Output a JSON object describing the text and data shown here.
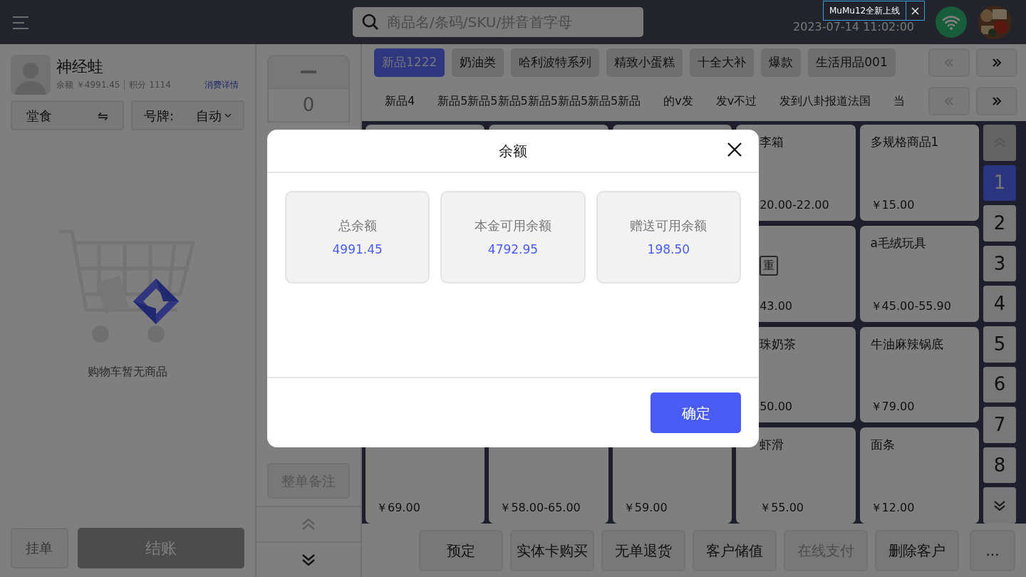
{
  "top_bar": {
    "search": {
      "placeholder": "商品名/条码/SKU/拼音首字母"
    },
    "datetime": "2023-07-14 11:02:00"
  },
  "notice": {
    "text": "MuMu12全新上线"
  },
  "customer": {
    "name": "神经蛙",
    "balance": "余额 ￥4991.45",
    "points": "积分 1114",
    "details_link": "消费详情"
  },
  "dining_mode": {
    "label": "堂食",
    "icon": "⇋"
  },
  "number_plate": {
    "label": "号牌:",
    "value": "自动"
  },
  "cart": {
    "empty_text": "购物车暂无商品"
  },
  "quantity": {
    "value": "0"
  },
  "order_note": "整单备注",
  "hold_button": {
    "label": "挂单",
    "disabled": true
  },
  "checkout_button": {
    "label": "结账",
    "disabled": true
  },
  "categories": [
    {
      "label": "新品1222",
      "selected": true
    },
    {
      "label": "奶油类",
      "selected": false
    },
    {
      "label": "哈利波特系列",
      "selected": false
    },
    {
      "label": "精致小蛋糕",
      "selected": false
    },
    {
      "label": "十全大补",
      "selected": false
    },
    {
      "label": "爆款",
      "selected": false
    },
    {
      "label": "生活用品001",
      "selected": false
    }
  ],
  "category_nav": {
    "prev_disabled": true,
    "next_disabled": false
  },
  "subcategories": [
    "新品4",
    "新品5新品5新品5新品5新品5新品5新品",
    "的v发",
    "发v不过",
    "发到八卦报道法国",
    "当"
  ],
  "subcategory_nav": {
    "prev_disabled": true,
    "next_disabled": false
  },
  "product_rows": [
    [
      {
        "kind": "plain"
      },
      {
        "kind": "plain"
      },
      {
        "kind": "plain"
      },
      {
        "kind": "partial",
        "name": "李箱",
        "price": "20.00-22.00"
      },
      {
        "kind": "full",
        "name": "多规格商品1",
        "price": "￥15.00"
      }
    ],
    [
      {
        "kind": "partial",
        "tag": "重",
        "price": "43.00"
      },
      {
        "kind": "full",
        "name": "a毛绒玩具",
        "price": "￥45.00-55.90"
      }
    ],
    [
      {
        "kind": "partial",
        "name": "珠奶茶",
        "price": "50.00"
      },
      {
        "kind": "full",
        "name": "牛油麻辣锅底",
        "price": "￥79.00"
      }
    ],
    [
      {
        "kind": "full",
        "price": "￥69.00"
      },
      {
        "kind": "full",
        "price": "￥58.00-65.00"
      },
      {
        "kind": "full",
        "price": "￥59.00"
      },
      {
        "kind": "partial",
        "name": "虾滑",
        "price": "￥55.00"
      },
      {
        "kind": "full",
        "name": "面条",
        "price": "￥12.00"
      }
    ]
  ],
  "pager": {
    "up_disabled": true,
    "down_disabled": false,
    "pages": [
      {
        "label": "1",
        "selected": true
      },
      {
        "label": "2",
        "selected": false
      },
      {
        "label": "3",
        "selected": false
      },
      {
        "label": "4",
        "selected": false
      },
      {
        "label": "5",
        "selected": false
      },
      {
        "label": "6",
        "selected": false
      },
      {
        "label": "7",
        "selected": false
      },
      {
        "label": "8",
        "selected": false
      }
    ]
  },
  "actions": [
    {
      "label": "预定",
      "disabled": false
    },
    {
      "label": "实体卡购买",
      "disabled": false
    },
    {
      "label": "无单退货",
      "disabled": false
    },
    {
      "label": "客户储值",
      "disabled": false
    },
    {
      "label": "在线支付",
      "disabled": true
    },
    {
      "label": "删除客户",
      "disabled": false
    },
    {
      "label": "...",
      "disabled": false
    }
  ],
  "modal": {
    "title": "余额",
    "balances": [
      {
        "label": "总余额",
        "value": "4991.45"
      },
      {
        "label": "本金可用余额",
        "value": "4792.95"
      },
      {
        "label": "赠送可用余额",
        "value": "198.50"
      }
    ],
    "confirm": "确定"
  }
}
